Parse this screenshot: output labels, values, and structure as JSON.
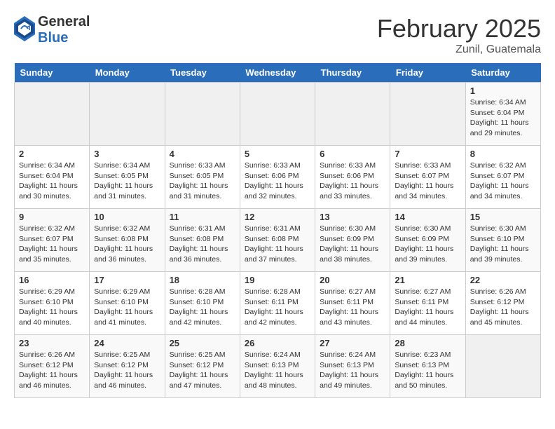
{
  "header": {
    "logo_general": "General",
    "logo_blue": "Blue",
    "title": "February 2025",
    "subtitle": "Zunil, Guatemala"
  },
  "days_of_week": [
    "Sunday",
    "Monday",
    "Tuesday",
    "Wednesday",
    "Thursday",
    "Friday",
    "Saturday"
  ],
  "weeks": [
    [
      {
        "day": "",
        "info": ""
      },
      {
        "day": "",
        "info": ""
      },
      {
        "day": "",
        "info": ""
      },
      {
        "day": "",
        "info": ""
      },
      {
        "day": "",
        "info": ""
      },
      {
        "day": "",
        "info": ""
      },
      {
        "day": "1",
        "info": "Sunrise: 6:34 AM\nSunset: 6:04 PM\nDaylight: 11 hours\nand 29 minutes."
      }
    ],
    [
      {
        "day": "2",
        "info": "Sunrise: 6:34 AM\nSunset: 6:04 PM\nDaylight: 11 hours\nand 30 minutes."
      },
      {
        "day": "3",
        "info": "Sunrise: 6:34 AM\nSunset: 6:05 PM\nDaylight: 11 hours\nand 31 minutes."
      },
      {
        "day": "4",
        "info": "Sunrise: 6:33 AM\nSunset: 6:05 PM\nDaylight: 11 hours\nand 31 minutes."
      },
      {
        "day": "5",
        "info": "Sunrise: 6:33 AM\nSunset: 6:06 PM\nDaylight: 11 hours\nand 32 minutes."
      },
      {
        "day": "6",
        "info": "Sunrise: 6:33 AM\nSunset: 6:06 PM\nDaylight: 11 hours\nand 33 minutes."
      },
      {
        "day": "7",
        "info": "Sunrise: 6:33 AM\nSunset: 6:07 PM\nDaylight: 11 hours\nand 34 minutes."
      },
      {
        "day": "8",
        "info": "Sunrise: 6:32 AM\nSunset: 6:07 PM\nDaylight: 11 hours\nand 34 minutes."
      }
    ],
    [
      {
        "day": "9",
        "info": "Sunrise: 6:32 AM\nSunset: 6:07 PM\nDaylight: 11 hours\nand 35 minutes."
      },
      {
        "day": "10",
        "info": "Sunrise: 6:32 AM\nSunset: 6:08 PM\nDaylight: 11 hours\nand 36 minutes."
      },
      {
        "day": "11",
        "info": "Sunrise: 6:31 AM\nSunset: 6:08 PM\nDaylight: 11 hours\nand 36 minutes."
      },
      {
        "day": "12",
        "info": "Sunrise: 6:31 AM\nSunset: 6:08 PM\nDaylight: 11 hours\nand 37 minutes."
      },
      {
        "day": "13",
        "info": "Sunrise: 6:30 AM\nSunset: 6:09 PM\nDaylight: 11 hours\nand 38 minutes."
      },
      {
        "day": "14",
        "info": "Sunrise: 6:30 AM\nSunset: 6:09 PM\nDaylight: 11 hours\nand 39 minutes."
      },
      {
        "day": "15",
        "info": "Sunrise: 6:30 AM\nSunset: 6:10 PM\nDaylight: 11 hours\nand 39 minutes."
      }
    ],
    [
      {
        "day": "16",
        "info": "Sunrise: 6:29 AM\nSunset: 6:10 PM\nDaylight: 11 hours\nand 40 minutes."
      },
      {
        "day": "17",
        "info": "Sunrise: 6:29 AM\nSunset: 6:10 PM\nDaylight: 11 hours\nand 41 minutes."
      },
      {
        "day": "18",
        "info": "Sunrise: 6:28 AM\nSunset: 6:10 PM\nDaylight: 11 hours\nand 42 minutes."
      },
      {
        "day": "19",
        "info": "Sunrise: 6:28 AM\nSunset: 6:11 PM\nDaylight: 11 hours\nand 42 minutes."
      },
      {
        "day": "20",
        "info": "Sunrise: 6:27 AM\nSunset: 6:11 PM\nDaylight: 11 hours\nand 43 minutes."
      },
      {
        "day": "21",
        "info": "Sunrise: 6:27 AM\nSunset: 6:11 PM\nDaylight: 11 hours\nand 44 minutes."
      },
      {
        "day": "22",
        "info": "Sunrise: 6:26 AM\nSunset: 6:12 PM\nDaylight: 11 hours\nand 45 minutes."
      }
    ],
    [
      {
        "day": "23",
        "info": "Sunrise: 6:26 AM\nSunset: 6:12 PM\nDaylight: 11 hours\nand 46 minutes."
      },
      {
        "day": "24",
        "info": "Sunrise: 6:25 AM\nSunset: 6:12 PM\nDaylight: 11 hours\nand 46 minutes."
      },
      {
        "day": "25",
        "info": "Sunrise: 6:25 AM\nSunset: 6:12 PM\nDaylight: 11 hours\nand 47 minutes."
      },
      {
        "day": "26",
        "info": "Sunrise: 6:24 AM\nSunset: 6:13 PM\nDaylight: 11 hours\nand 48 minutes."
      },
      {
        "day": "27",
        "info": "Sunrise: 6:24 AM\nSunset: 6:13 PM\nDaylight: 11 hours\nand 49 minutes."
      },
      {
        "day": "28",
        "info": "Sunrise: 6:23 AM\nSunset: 6:13 PM\nDaylight: 11 hours\nand 50 minutes."
      },
      {
        "day": "",
        "info": ""
      }
    ]
  ]
}
